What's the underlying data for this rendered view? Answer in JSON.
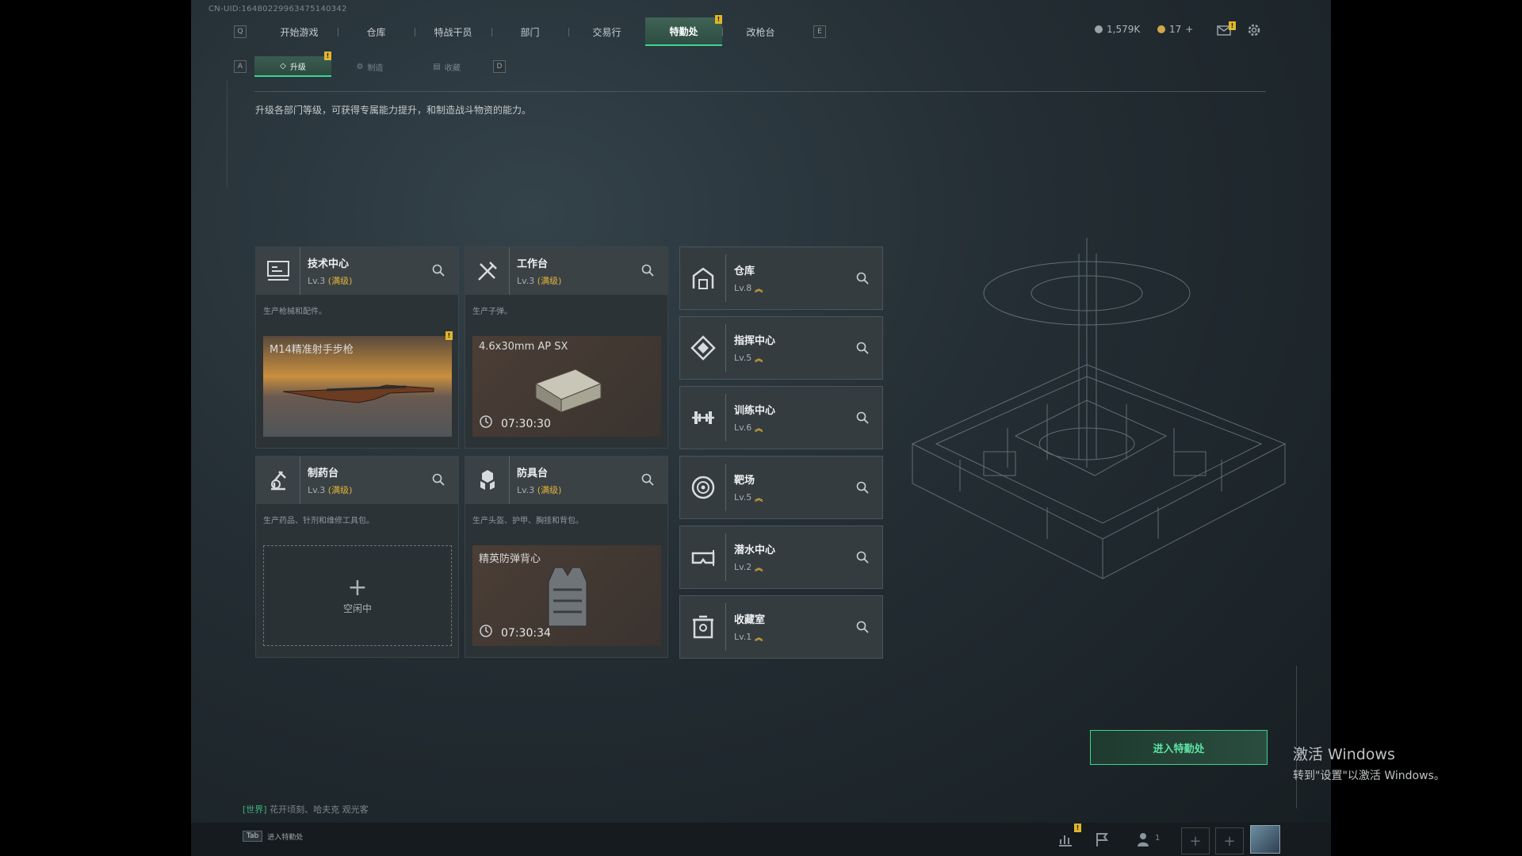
{
  "uid": "CN-UID:16480229963475140342",
  "nav": {
    "left_key": "Q",
    "right_key": "E",
    "tabs": [
      "开始游戏",
      "仓库",
      "特战干员",
      "部门",
      "交易行",
      "特勤处",
      "改枪台"
    ],
    "active": "特勤处",
    "badge": "!"
  },
  "currency": {
    "primary": "1,579K",
    "secondary": "17",
    "plus": "+"
  },
  "subnav": {
    "left_key": "A",
    "right_key": "D",
    "tabs": [
      "升级",
      "制造",
      "收藏"
    ],
    "active": "升级",
    "badge": "!"
  },
  "description": "升级各部门等级，可获得专属能力提升，和制造战斗物资的能力。",
  "facilities": [
    {
      "name": "技术中心",
      "level": "Lv.3",
      "max_label": "(满级)",
      "desc": "生产枪械和配件。",
      "icon": "tech-center-icon",
      "slot": {
        "type": "item",
        "item": "M14精准射手步枪",
        "badge": "!"
      }
    },
    {
      "name": "工作台",
      "level": "Lv.3",
      "max_label": "(满级)",
      "desc": "生产子弹。",
      "icon": "hammer-wrench-icon",
      "slot": {
        "type": "producing",
        "item": "4.6x30mm AP SX",
        "timer": "07:30:30"
      }
    },
    {
      "name": "制药台",
      "level": "Lv.3",
      "max_label": "(满级)",
      "desc": "生产药品、针剂和维修工具包。",
      "icon": "pharmacy-icon",
      "slot": {
        "type": "empty",
        "plus": "+",
        "label": "空闲中"
      }
    },
    {
      "name": "防具台",
      "level": "Lv.3",
      "max_label": "(满级)",
      "desc": "生产头盔、护甲、胸挂和背包。",
      "icon": "armor-bench-icon",
      "slot": {
        "type": "producing",
        "item": "精英防弹背心",
        "timer": "07:30:34"
      }
    }
  ],
  "departments": [
    {
      "name": "仓库",
      "level": "Lv.8",
      "icon": "warehouse-icon"
    },
    {
      "name": "指挥中心",
      "level": "Lv.5",
      "icon": "command-center-icon"
    },
    {
      "name": "训练中心",
      "level": "Lv.6",
      "icon": "dumbbell-icon"
    },
    {
      "name": "靶场",
      "level": "Lv.5",
      "icon": "target-icon"
    },
    {
      "name": "潜水中心",
      "level": "Lv.2",
      "icon": "diving-mask-icon"
    },
    {
      "name": "收藏室",
      "level": "Lv.1",
      "icon": "trophy-room-icon"
    }
  ],
  "enter_button": "进入特勤处",
  "chat": {
    "channel": "[世界]",
    "message": "花开顷刻、哈夫克 观光客"
  },
  "bottom": {
    "tab_key": "Tab",
    "tab_label": "进入特勤处",
    "friends_count": "1",
    "badge": "!"
  },
  "activation": {
    "title": "激活 Windows",
    "subtitle": "转到\"设置\"以激活 Windows。"
  },
  "colors": {
    "accent": "#3dd48f",
    "gold": "#e3b337",
    "badge": "#e0b62a"
  }
}
